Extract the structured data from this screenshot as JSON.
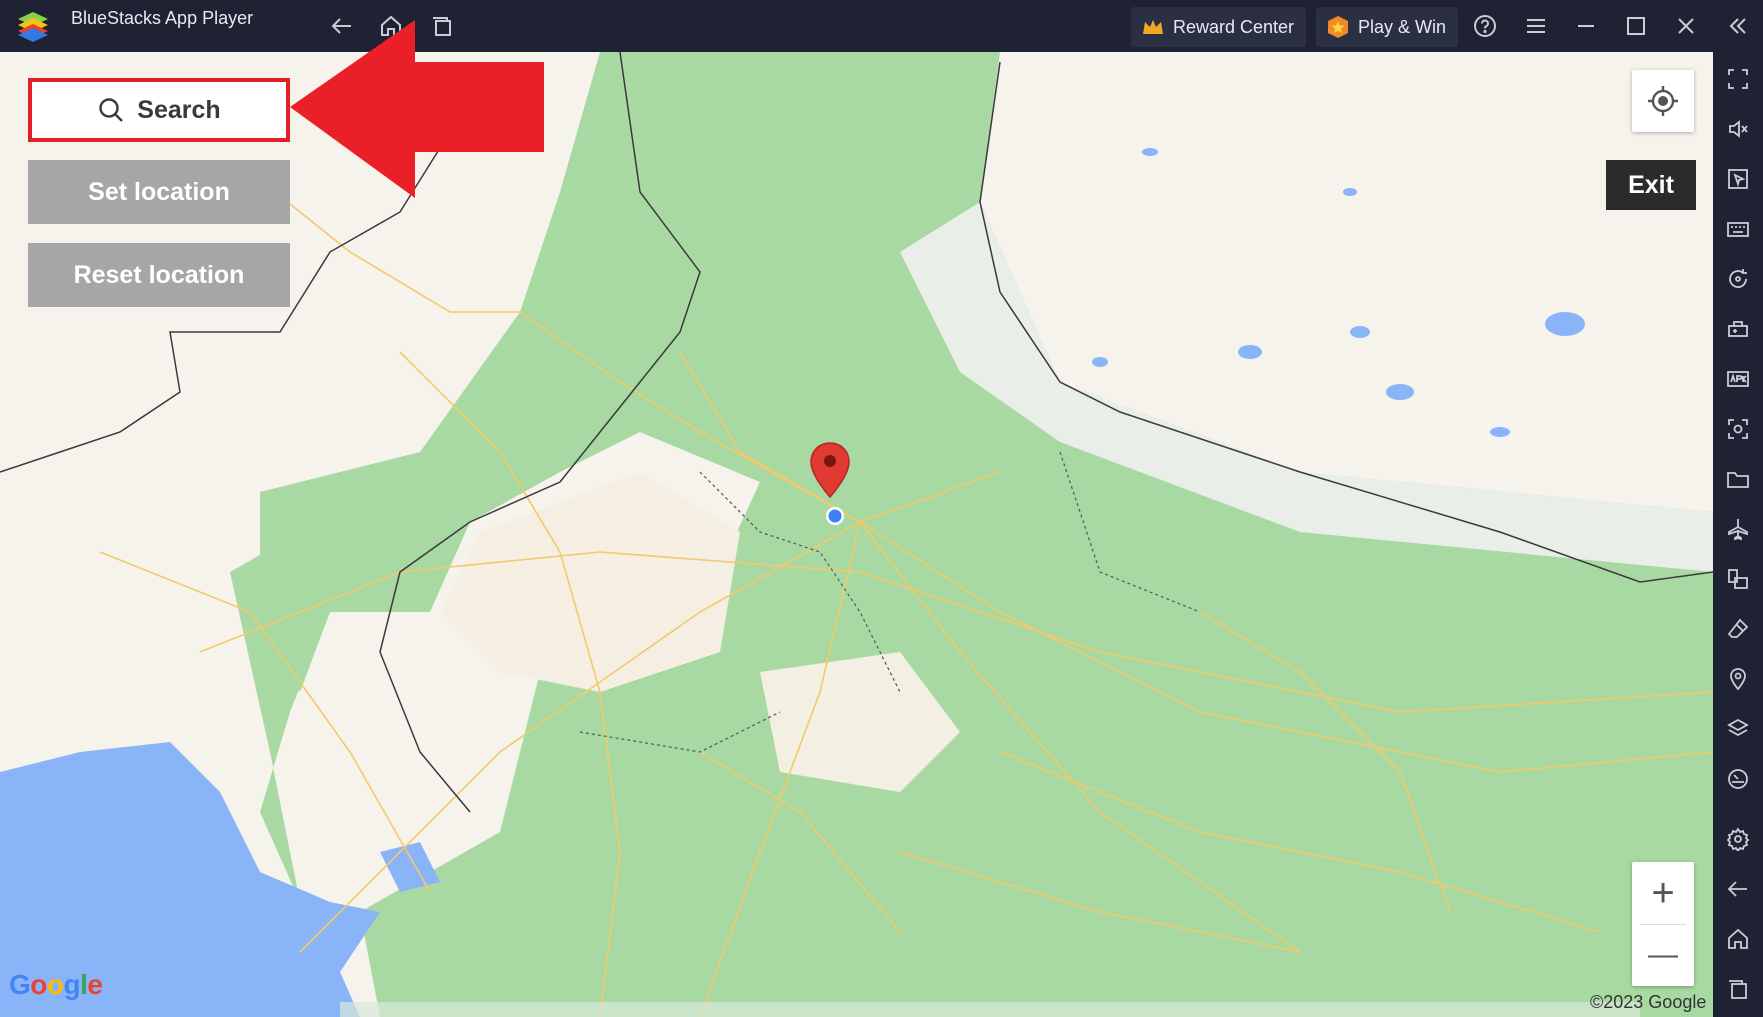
{
  "window": {
    "title": "BlueStacks App Player",
    "reward_center_label": "Reward Center",
    "play_win_label": "Play & Win"
  },
  "map": {
    "search_label": "Search",
    "set_location_label": "Set location",
    "reset_location_label": "Reset location",
    "exit_label": "Exit",
    "zoom_in_label": "+",
    "zoom_out_label": "—",
    "copyright": "©2023 Google",
    "provider_logo": "Google"
  },
  "colors": {
    "highlight": "#e3202a",
    "pin": "#e03a32",
    "user_dot": "#3b82f6",
    "land": "#f6f3ec",
    "vegetation": "#a8d8a4",
    "water": "#8ab4f8"
  },
  "sidebar_icons": [
    "fullscreen-icon",
    "volume-mute-icon",
    "pointer-icon",
    "keyboard-icon",
    "rotate-icon",
    "controller-icon",
    "apk-icon",
    "screenshot-icon",
    "folder-icon",
    "airplane-icon",
    "multi-instance-icon",
    "eraser-icon",
    "location-icon",
    "layers-icon",
    "speed-icon",
    "settings-icon",
    "back-icon",
    "home-icon",
    "recents-icon"
  ]
}
